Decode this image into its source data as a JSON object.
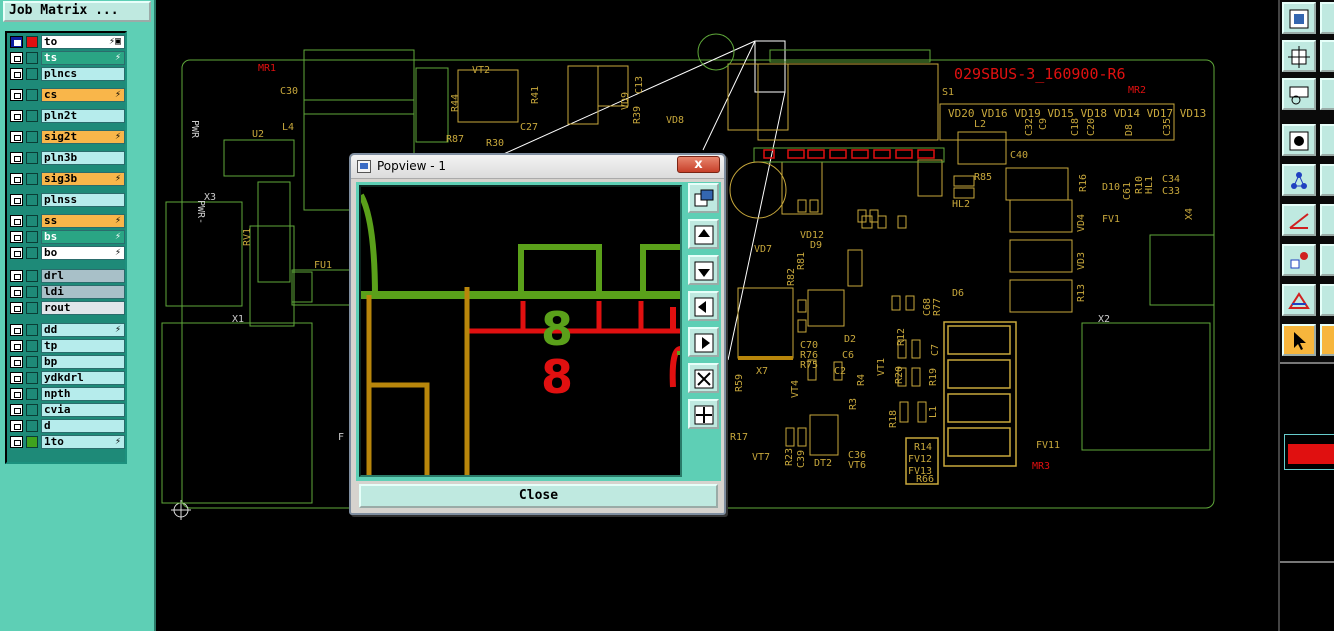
{
  "job_matrix": {
    "label": "Job Matrix ..."
  },
  "layers": [
    {
      "name": "to",
      "style": "white",
      "color": "#e01010",
      "checked": true,
      "flag": "⚡▣"
    },
    {
      "name": "ts",
      "style": "green",
      "color": "#1e8a78",
      "flag": "⚡"
    },
    {
      "name": "plncs",
      "style": "plain",
      "color": "#1e8a78",
      "flag": ""
    },
    {
      "name": "cs",
      "style": "orange",
      "color": "#1e8a78",
      "flag": "⚡"
    },
    {
      "name": "pln2t",
      "style": "plain",
      "color": "#1e8a78",
      "flag": ""
    },
    {
      "name": "sig2t",
      "style": "orange",
      "color": "#1e8a78",
      "flag": "⚡"
    },
    {
      "name": "pln3b",
      "style": "plain",
      "color": "#1e8a78",
      "flag": ""
    },
    {
      "name": "sig3b",
      "style": "orange",
      "color": "#1e8a78",
      "flag": "⚡"
    },
    {
      "name": "plnss",
      "style": "plain",
      "color": "#1e8a78",
      "flag": ""
    },
    {
      "name": "ss",
      "style": "orange",
      "color": "#1e8a78",
      "flag": "⚡"
    },
    {
      "name": "bs",
      "style": "green",
      "color": "#1e8a78",
      "flag": "⚡"
    },
    {
      "name": "bo",
      "style": "white",
      "color": "#1e8a78",
      "flag": "⚡"
    },
    {
      "name": "drl",
      "style": "grey",
      "color": "#1e8a78",
      "flag": ""
    },
    {
      "name": "ldi",
      "style": "grey",
      "color": "#1e8a78",
      "flag": ""
    },
    {
      "name": "rout",
      "style": "lgrey",
      "color": "#1e8a78",
      "flag": ""
    },
    {
      "name": "dd",
      "style": "plain",
      "color": "#1e8a78",
      "flag": "⚡"
    },
    {
      "name": "tp",
      "style": "plain",
      "color": "#1e8a78",
      "flag": ""
    },
    {
      "name": "bp",
      "style": "plain",
      "color": "#1e8a78",
      "flag": ""
    },
    {
      "name": "ydkdrl",
      "style": "plain",
      "color": "#1e8a78",
      "flag": ""
    },
    {
      "name": "npth",
      "style": "plain",
      "color": "#1e8a78",
      "flag": ""
    },
    {
      "name": "cvia",
      "style": "plain",
      "color": "#1e8a78",
      "flag": ""
    },
    {
      "name": "d",
      "style": "plain",
      "color": "#1e8a78",
      "flag": ""
    },
    {
      "name": "1to",
      "style": "plain",
      "color": "#3fa21e",
      "flag": "⚡"
    }
  ],
  "board": {
    "title_text": "029SBUS-3_160900-R6",
    "labels": [
      "MR1",
      "C30",
      "VT2",
      "R41",
      "VD9",
      "C13",
      "R39",
      "VD8",
      "R44",
      "R87",
      "R30",
      "C27",
      "L4",
      "U2",
      "PWR",
      "PWR-",
      "X3",
      "RV1",
      "FU1",
      "X1",
      "VD20",
      "VD16",
      "VD19",
      "VD15",
      "VD18",
      "VD14",
      "VD17",
      "VD13",
      "L2",
      "C32",
      "C9",
      "C18",
      "C20",
      "D8",
      "C35",
      "C40",
      "S1",
      "MR2",
      "R85",
      "HL2",
      "R16",
      "D10",
      "C61",
      "R10",
      "HL1",
      "C34",
      "C33",
      "FV1",
      "X4",
      "VD4",
      "VD3",
      "R13",
      "X2",
      "VD7",
      "D9",
      "VD12",
      "R82",
      "R81",
      "D2",
      "C68",
      "R77",
      "D6",
      "X7",
      "C70",
      "R76",
      "R75",
      "C6",
      "C2",
      "R59",
      "VT4",
      "R4",
      "R3",
      "VT1",
      "R12",
      "C7",
      "R20",
      "R19",
      "R18",
      "L1",
      "R17",
      "VT7",
      "R23",
      "C39",
      "DT2",
      "C36",
      "VT6",
      "R14",
      "FV12",
      "FV13",
      "R66",
      "FV11",
      "MR3"
    ]
  },
  "popview": {
    "title": "Popview - 1",
    "close_x": "x",
    "close_button": "Close",
    "green_digit": "8",
    "red_digit": "8",
    "tools": [
      "zoom-window-icon",
      "pan-up-icon",
      "pan-down-icon",
      "pan-left-icon",
      "pan-right-icon",
      "zoom-fit-icon",
      "zoom-home-icon"
    ]
  },
  "right_toolbar": {
    "tools": [
      "zoom-in-icon",
      "fit-screen-icon",
      "measure-icon",
      "snap-icon",
      "net-icon",
      "angle-icon",
      "pad-icon",
      "drc-icon",
      "select-pointer-icon"
    ]
  },
  "colors": {
    "panel": "#5ecfb5",
    "board_outline": "#5fa83a",
    "silk": "#c8a83c",
    "top_copper": "#d9c070",
    "signal_green": "#5aa01a",
    "signal_red": "#e01010",
    "signal_gold": "#b8860b"
  }
}
